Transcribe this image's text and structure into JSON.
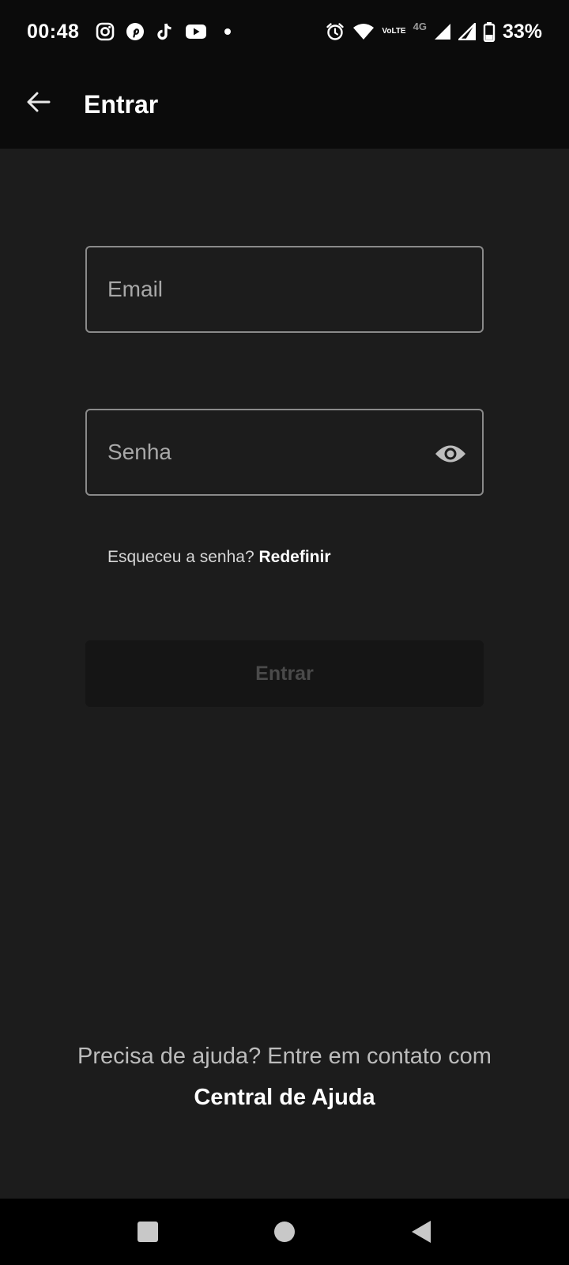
{
  "status_bar": {
    "time": "00:48",
    "left_icons": [
      "instagram-icon",
      "pinterest-icon",
      "tiktok-icon",
      "youtube-icon",
      "notification-dot"
    ],
    "right_icons": [
      "alarm-icon",
      "wifi-icon",
      "volte-icon",
      "4g-icon",
      "signal-icon",
      "signal-icon",
      "battery-icon"
    ],
    "volte_label_top": "Vo",
    "volte_label_bottom": "LTE",
    "network_label": "4G",
    "battery_percent": "33%"
  },
  "app_bar": {
    "title": "Entrar"
  },
  "form": {
    "email_placeholder": "Email",
    "email_value": "",
    "password_placeholder": "Senha",
    "password_value": "",
    "forgot_prompt": "Esqueceu a senha?",
    "forgot_link": "Redefinir",
    "submit_label": "Entrar"
  },
  "help": {
    "text": "Precisa de ajuda? Entre em contato com",
    "link": "Central de Ajuda"
  },
  "colors": {
    "background": "#1c1c1c",
    "bar_background": "#0b0b0b",
    "field_border": "#8a8a8a",
    "disabled_button_bg": "#151515",
    "disabled_button_text": "#4a4a4a"
  }
}
